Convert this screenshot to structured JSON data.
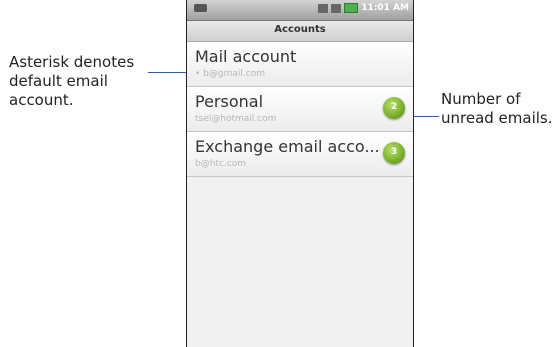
{
  "callouts": {
    "left": "Asterisk denotes default email account.",
    "left_lines": [
      "Asterisk denotes",
      "default email",
      "account."
    ],
    "right_lines": [
      "Number of",
      "unread emails."
    ]
  },
  "status_bar": {
    "time": "11:01 AM"
  },
  "screen": {
    "title": "Accounts"
  },
  "accounts": [
    {
      "name": "Mail account",
      "email": "• b@gmail.com",
      "unread": ""
    },
    {
      "name": "Personal",
      "email": "tsel@hotmail.com",
      "unread": "2"
    },
    {
      "name": "Exchange email acco...",
      "email": "b@htc.com",
      "unread": "3"
    }
  ],
  "colors": {
    "accent_line": "#2f5fa3",
    "badge": "#6ea51f"
  }
}
